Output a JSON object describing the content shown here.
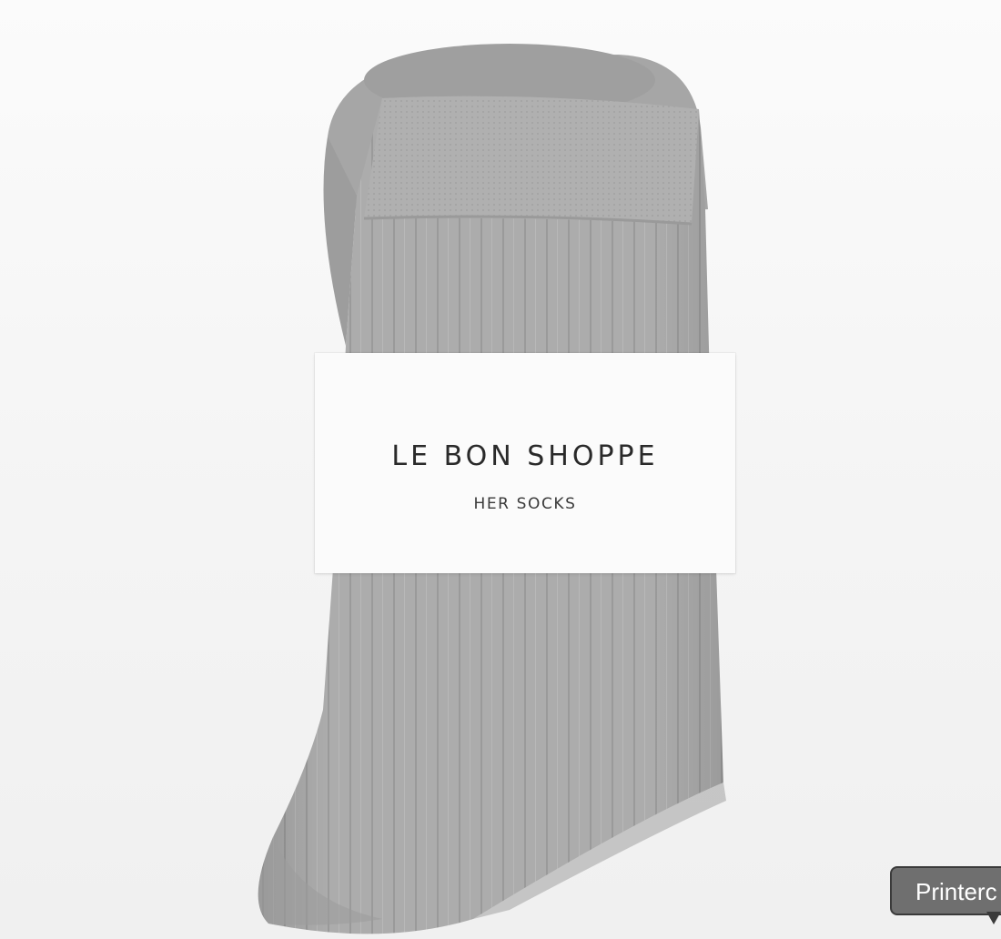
{
  "product_image": {
    "brand": "LE BON SHOPPE",
    "product": "HER SOCKS",
    "sock_color": "#a9a9a9",
    "sock_shadow": "#8f8f8f",
    "background_color": "#f6f6f6"
  },
  "tooltip": {
    "label": "Printerc"
  }
}
